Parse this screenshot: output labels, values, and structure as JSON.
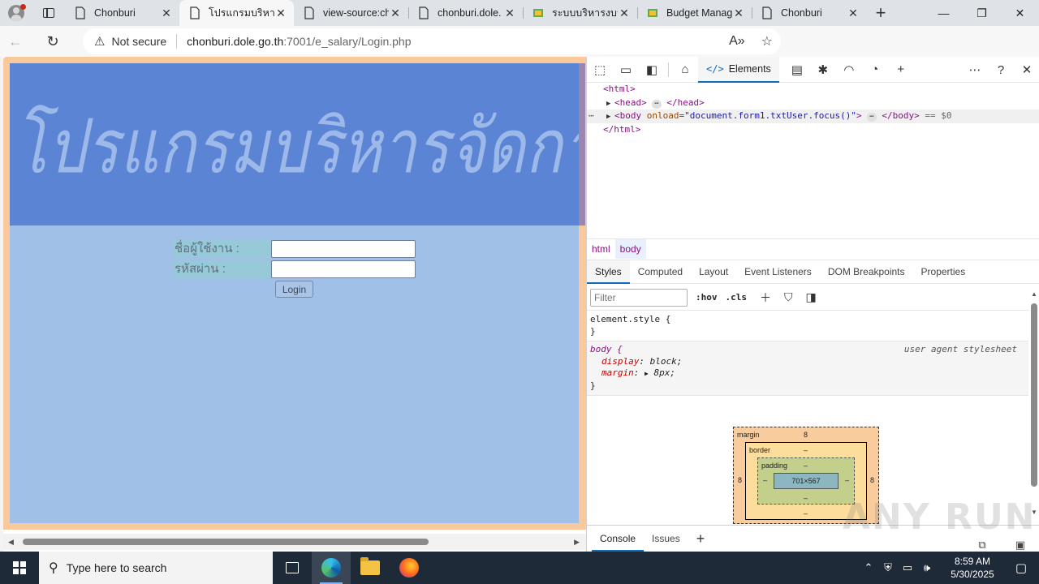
{
  "browser": {
    "tabs": [
      {
        "title": "Chonburi",
        "active": false
      },
      {
        "title": "โปรแกรมบริหาร",
        "active": true
      },
      {
        "title": "view-source:ch",
        "active": false
      },
      {
        "title": "chonburi.dole.",
        "active": false
      },
      {
        "title": "ระบบบริหารงบป",
        "active": false
      },
      {
        "title": "Budget Manag",
        "active": false
      },
      {
        "title": "Chonburi",
        "active": false
      }
    ],
    "address": {
      "security_label": "Not secure",
      "host": "chonburi.dole.go.th",
      "path": ":7001/e_salary/Login.php"
    }
  },
  "page": {
    "banner_text": "โปรแกรมบริหารจัดการเงินเดือน E-Salary สำนักงาน",
    "username_label": "ชื่อผู้ใช้งาน :",
    "password_label": "รหัสผ่าน :",
    "username_value": "",
    "password_value": "",
    "login_button": "Login"
  },
  "devtools": {
    "main_tab": "Elements",
    "dom": {
      "html_open": "<html>",
      "head": "<head>",
      "head_close": "</head>",
      "body_open": "<body",
      "body_attr_name": "onload",
      "body_attr_value": "\"document.form1.txtUser.focus()\"",
      "body_close": "</body>",
      "selected_marker": "== $0",
      "html_close": "</html>"
    },
    "breadcrumbs": [
      "html",
      "body"
    ],
    "subtabs": [
      "Styles",
      "Computed",
      "Layout",
      "Event Listeners",
      "DOM Breakpoints",
      "Properties"
    ],
    "filter_placeholder": "Filter",
    "hov": ":hov",
    "cls": ".cls",
    "styles": {
      "element_style": "element.style {",
      "close_brace": "}",
      "body_selector": "body {",
      "source": "user agent stylesheet",
      "display_prop": "display",
      "display_val": "block;",
      "margin_prop": "margin",
      "margin_val": "8px;"
    },
    "box_model": {
      "margin_label": "margin",
      "margin_value": "8",
      "margin_left": "8",
      "margin_right": "8",
      "border_label": "border",
      "border_value": "–",
      "padding_label": "padding",
      "padding_value": "–",
      "content_size": "701×567",
      "dash": "–"
    },
    "drawer_tabs": [
      "Console",
      "Issues"
    ]
  },
  "watermark": "ANY RUN",
  "taskbar": {
    "search_placeholder": "Type here to search",
    "time": "8:59 AM",
    "date": "5/30/2025"
  }
}
